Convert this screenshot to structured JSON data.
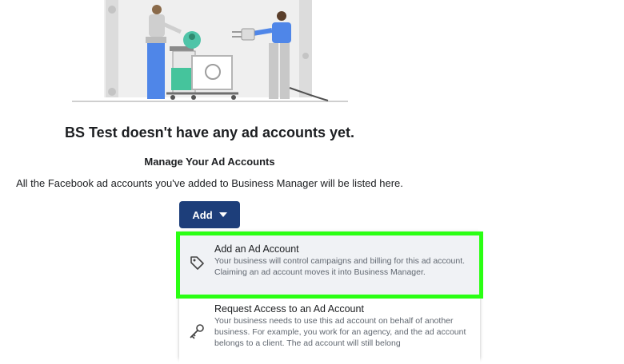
{
  "page": {
    "heading": "BS Test doesn't have any ad accounts yet.",
    "subheading": "Manage Your Ad Accounts",
    "description": "All the Facebook ad accounts you've added to Business Manager will be listed here."
  },
  "add_button": {
    "label": "Add"
  },
  "menu": {
    "items": [
      {
        "title": "Add an Ad Account",
        "description": "Your business will control campaigns and billing for this ad account. Claiming an ad account moves it into Business Manager.",
        "icon": "tag-icon"
      },
      {
        "title": "Request Access to an Ad Account",
        "description": "Your business needs to use this ad account on behalf of another business. For example, you work for an agency, and the ad account belongs to a client. The ad account will still belong",
        "icon": "key-icon"
      }
    ]
  },
  "colors": {
    "button_bg": "#1d3e7a",
    "highlight": "#2aff13",
    "figure_blue": "#4f86e8",
    "figure_teal": "#4fc4a8"
  }
}
